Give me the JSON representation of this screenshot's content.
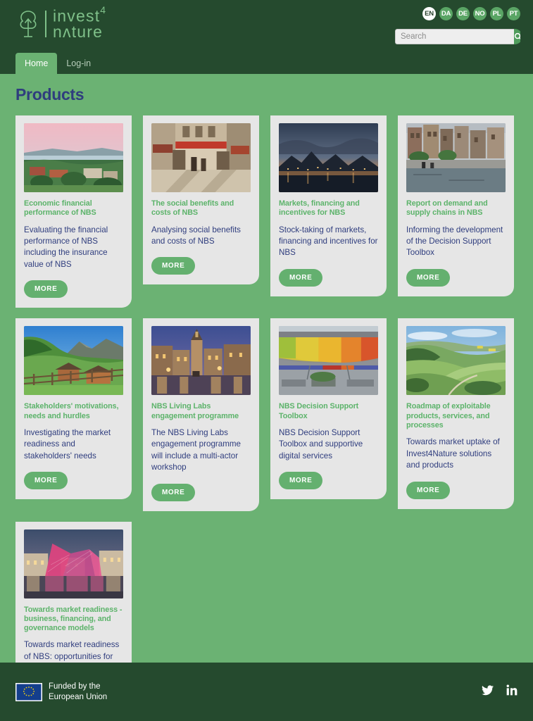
{
  "header": {
    "logo": {
      "icon": "tree-arrow-circle-logo",
      "line1": "invest",
      "superscript": "4",
      "line2": "nɅture"
    },
    "languages": [
      {
        "code": "EN",
        "active": true
      },
      {
        "code": "DA",
        "active": false
      },
      {
        "code": "DE",
        "active": false
      },
      {
        "code": "NO",
        "active": false
      },
      {
        "code": "PL",
        "active": false
      },
      {
        "code": "PT",
        "active": false
      }
    ],
    "search": {
      "placeholder": "Search",
      "value": "",
      "button_icon": "search-icon"
    }
  },
  "nav": {
    "items": [
      {
        "label": "Home",
        "active": true
      },
      {
        "label": "Log-in",
        "active": false
      }
    ]
  },
  "main": {
    "title": "Products",
    "more_label": "MORE",
    "cards": [
      {
        "title": "Economic financial performance of NBS",
        "desc": "Evaluating the financial performance of NBS including the insurance value of NBS",
        "image": "oslo-cityscape-at-dusk"
      },
      {
        "title": "The social benefits and costs of NBS",
        "desc": "Analysing social benefits and costs of NBS",
        "image": "pedestrian-market-street"
      },
      {
        "title": "Markets, financing and incentives for NBS",
        "desc": "Stock-taking of markets, financing and incentives for NBS",
        "image": "arctic-fjord-town-at-night"
      },
      {
        "title": "Report on demand and supply chains in NBS",
        "desc": "Informing the development of the Decision Support Toolbox",
        "image": "copenhagen-canal-waterfront"
      },
      {
        "title": "Stakeholders' motivations, needs and hurdles",
        "desc": "Investigating the market readiness and stakeholders' needs",
        "image": "alpine-valley-with-chalets"
      },
      {
        "title": "NBS Living Labs engagement programme",
        "desc": "The NBS Living Labs engagement programme will include a multi-actor workshop",
        "image": "old-town-square-at-dusk"
      },
      {
        "title": "NBS Decision Support Toolbox",
        "desc": "NBS Decision Support Toolbox and supportive digital services",
        "image": "aros-rainbow-panorama-building"
      },
      {
        "title": "Roadmap of exploitable products, services, and processes",
        "desc": "Towards market uptake of Invest4Nature solutions and products",
        "image": "aerial-green-farmland-hills"
      },
      {
        "title": "Towards market readiness - business, financing, and governance models",
        "desc": "Towards market readiness of NBS: opportunities for new and diverse mechanism.",
        "image": "pink-lit-sculpture-on-plaza"
      }
    ]
  },
  "footer": {
    "eu_flag_icon": "eu-flag-icon",
    "funding_line1": "Funded by the",
    "funding_line2": "European Union",
    "socials": [
      {
        "name": "twitter-icon"
      },
      {
        "name": "linkedin-icon"
      }
    ]
  },
  "colors": {
    "dark_green": "#254a2e",
    "page_green": "#6bb273",
    "accent_green": "#5cb36a",
    "title_navy": "#2f3d7e",
    "card_bg": "#e6e6e6"
  }
}
